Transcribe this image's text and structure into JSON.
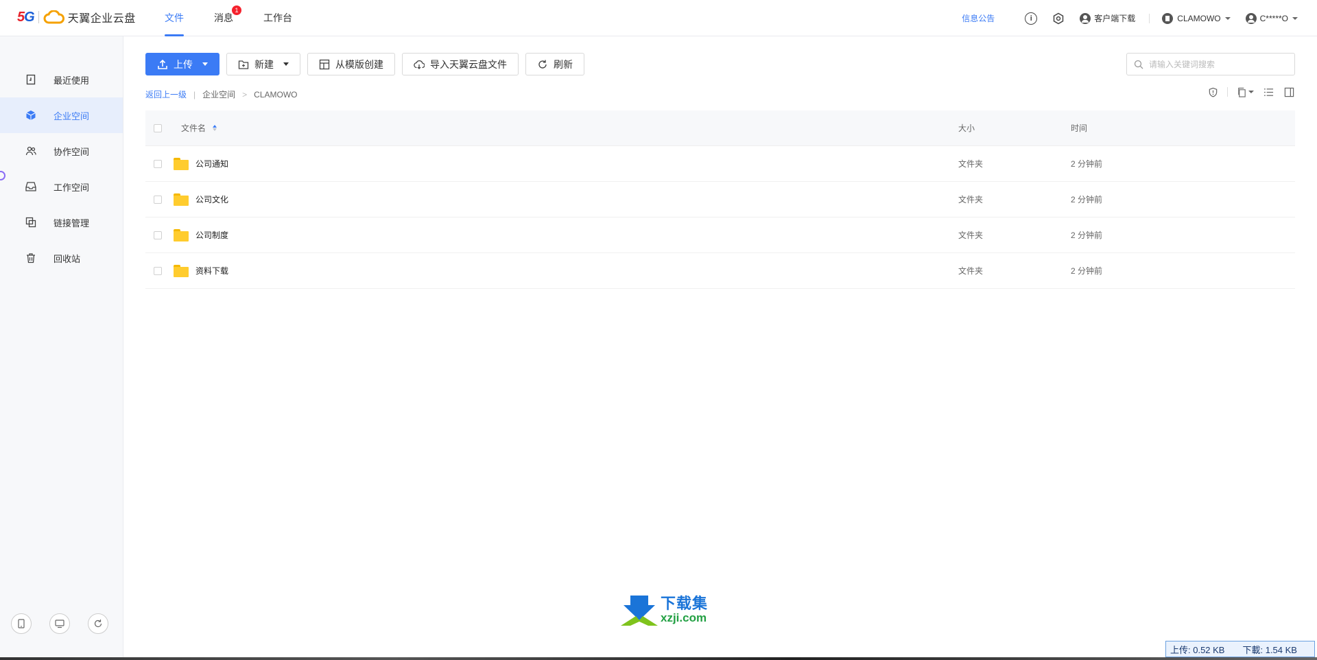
{
  "header": {
    "logo_5g": "5G",
    "app_name": "天翼企业云盘",
    "nav": [
      {
        "label": "文件",
        "active": true
      },
      {
        "label": "消息",
        "badge": "1"
      },
      {
        "label": "工作台"
      }
    ],
    "notice_link": "信息公告",
    "client_download": "客户端下载",
    "org_name": "CLAMOWO",
    "user_name": "C*****O"
  },
  "sidebar": {
    "items": [
      {
        "label": "最近使用",
        "icon": "recent-icon"
      },
      {
        "label": "企业空间",
        "icon": "cube-icon",
        "active": true
      },
      {
        "label": "协作空间",
        "icon": "team-icon"
      },
      {
        "label": "工作空间",
        "icon": "inbox-icon"
      },
      {
        "label": "链接管理",
        "icon": "link-icon"
      },
      {
        "label": "回收站",
        "icon": "trash-icon"
      }
    ]
  },
  "toolbar": {
    "upload": "上传",
    "new": "新建",
    "from_template": "从模版创建",
    "import": "导入天翼云盘文件",
    "refresh": "刷新"
  },
  "search": {
    "placeholder": "请输入关键词搜索"
  },
  "breadcrumb": {
    "back": "返回上一级",
    "sep1": "|",
    "path": [
      "企业空间",
      "CLAMOWO"
    ],
    "sep2": ">"
  },
  "table": {
    "columns": {
      "name": "文件名",
      "size": "大小",
      "time": "时间"
    },
    "rows": [
      {
        "name": "公司通知",
        "size": "文件夹",
        "time": "2 分钟前"
      },
      {
        "name": "公司文化",
        "size": "文件夹",
        "time": "2 分钟前"
      },
      {
        "name": "公司制度",
        "size": "文件夹",
        "time": "2 分钟前"
      },
      {
        "name": "资料下载",
        "size": "文件夹",
        "time": "2 分钟前"
      }
    ]
  },
  "watermark": {
    "cn": "下载集",
    "url": "xzji.com"
  },
  "status": {
    "upload": "上传: 0.52 KB",
    "download": "下載: 1.54 KB"
  },
  "colors": {
    "accent": "#3b7bf5",
    "folder": "#ffcc2e",
    "badge": "#f5222d"
  }
}
